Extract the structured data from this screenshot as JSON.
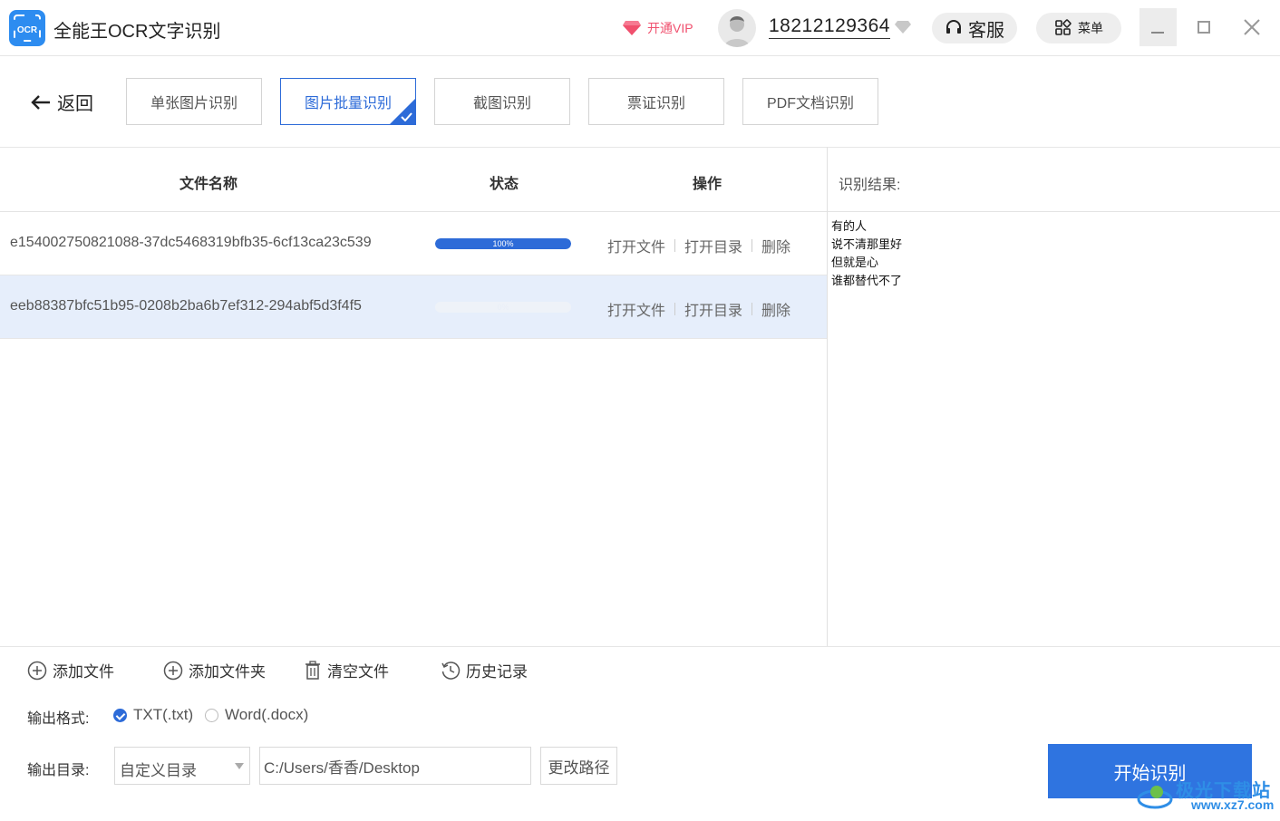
{
  "app": {
    "title": "全能王OCR文字识别",
    "logo_text": "OCR",
    "vip_label": "开通VIP",
    "phone": "18212129364",
    "kefu_label": "客服",
    "menu_label": "菜单"
  },
  "toolbar": {
    "back_label": "返回",
    "tabs": [
      {
        "label": "单张图片识别",
        "active": false
      },
      {
        "label": "图片批量识别",
        "active": true
      },
      {
        "label": "截图识别",
        "active": false
      },
      {
        "label": "票证识别",
        "active": false
      },
      {
        "label": "PDF文档识别",
        "active": false
      }
    ]
  },
  "table": {
    "headers": {
      "name": "文件名称",
      "status": "状态",
      "ops": "操作"
    },
    "rows": [
      {
        "name": "e154002750821088-37dc5468319bfb35-6cf13ca23c539",
        "progress": 1.0,
        "progress_text": "100%",
        "selected": false
      },
      {
        "name": "eeb88387bfc51b95-0208b2ba6b7ef312-294abf5d3f4f5",
        "progress": 0.0,
        "progress_text": "0%",
        "selected": true
      }
    ],
    "op_labels": {
      "open_file": "打开文件",
      "open_dir": "打开目录",
      "delete": "删除"
    }
  },
  "result": {
    "label": "识别结果:",
    "lines": [
      "有的人",
      "说不清那里好",
      "但就是心",
      "谁都替代不了"
    ]
  },
  "bottom": {
    "add_file": "添加文件",
    "add_folder": "添加文件夹",
    "clear_files": "清空文件",
    "history": "历史记录",
    "format_label": "输出格式:",
    "format_txt": "TXT(.txt)",
    "format_word": "Word(.docx)",
    "selected_format": "TXT(.txt)",
    "dir_label": "输出目录:",
    "dir_option": "自定义目录",
    "path_value": "C:/Users/香香/Desktop",
    "change_path": "更改路径",
    "start_label": "开始识别"
  },
  "watermark": {
    "text": "极光下载站",
    "url": "www.xz7.com"
  },
  "colors": {
    "accent": "#2d6bd8",
    "vip": "#f0506e",
    "selected_row": "#e6eefb"
  }
}
